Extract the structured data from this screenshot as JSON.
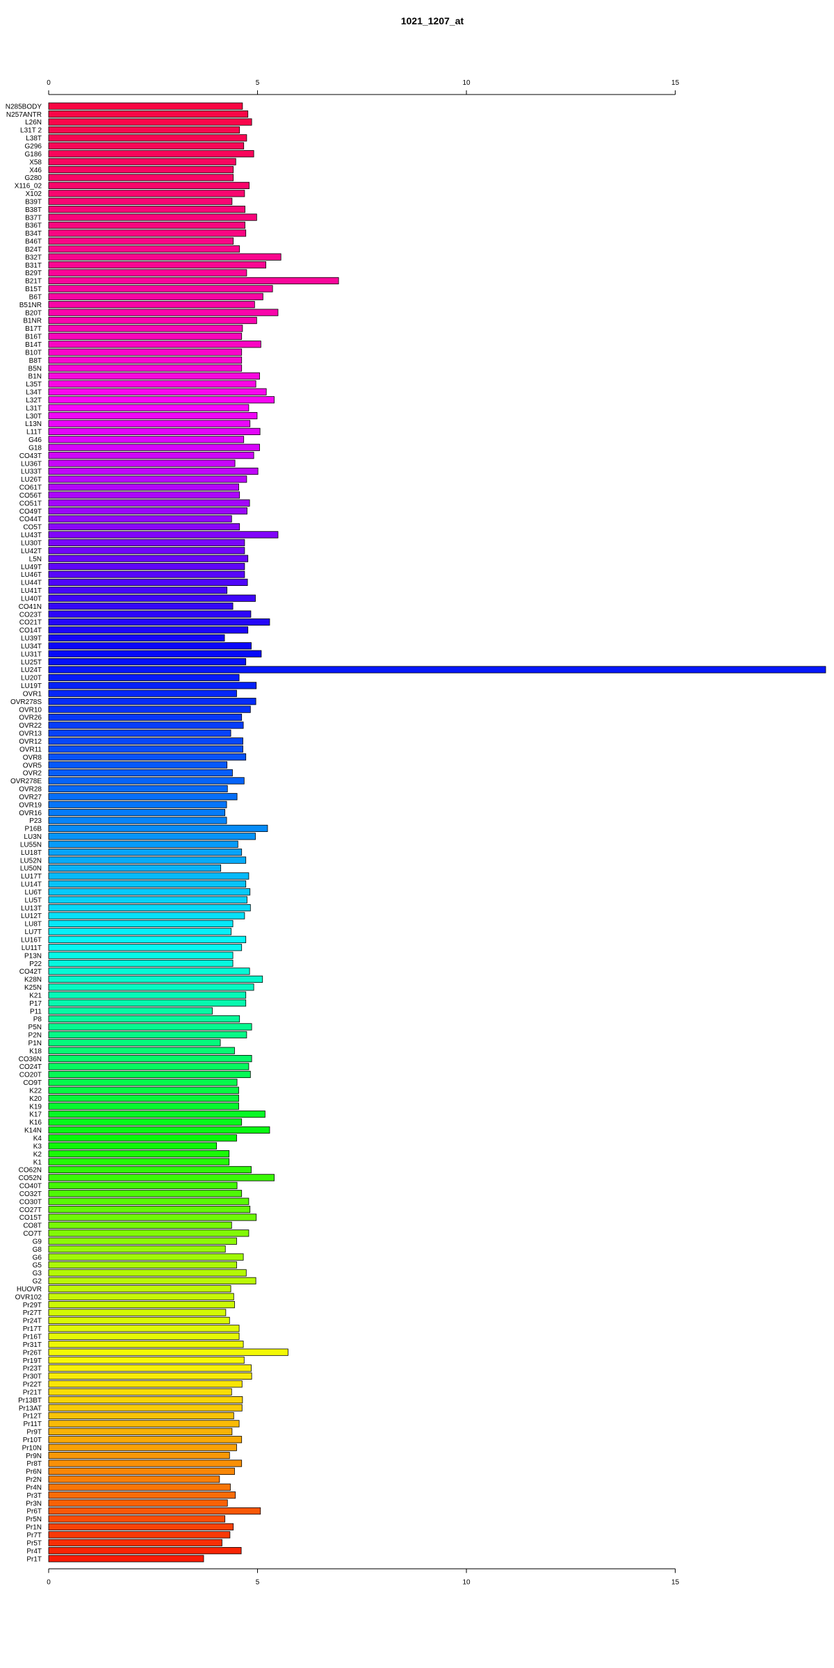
{
  "chart_data": {
    "type": "bar",
    "orientation": "horizontal",
    "title": "1021_1207_at",
    "xlabel": "",
    "ylabel": "",
    "xlim": [
      0,
      18.6
    ],
    "xticks": [
      0,
      5,
      10,
      15
    ],
    "grid": false,
    "legend": "none",
    "color_scheme": "rainbow",
    "bar_border_color": "#000000",
    "categories": [
      "N285BODY",
      "N257ANTR",
      "L26N",
      "L31T 2",
      "L38T",
      "G296",
      "G186",
      "X58",
      "X46",
      "G280",
      "X116_02",
      "X102",
      "B39T",
      "B38T",
      "B37T",
      "B36T",
      "B34T",
      "B46T",
      "B24T",
      "B32T",
      "B31T",
      "B29T",
      "B21T",
      "B15T",
      "B6T",
      "B51NR",
      "B20T",
      "B1NR",
      "B17T",
      "B16T",
      "B14T",
      "B10T",
      "B8T",
      "B5N",
      "B1N",
      "L35T",
      "L34T",
      "L32T",
      "L31T",
      "L30T",
      "L13N",
      "L11T",
      "G46",
      "G18",
      "CO43T",
      "LU36T",
      "LU33T",
      "LU26T",
      "CO61T",
      "CO56T",
      "CO51T",
      "CO49T",
      "CO44T",
      "CO5T",
      "LU43T",
      "LU30T",
      "LU42T",
      "L5N",
      "LU49T",
      "LU46T",
      "LU44T",
      "LU41T",
      "LU40T",
      "CO41N",
      "CO23T",
      "CO21T",
      "CO14T",
      "LU39T",
      "LU34T",
      "LU31T",
      "LU25T",
      "LU24T",
      "LU20T",
      "LU19T",
      "OVR1",
      "OVR278S",
      "OVR10",
      "OVR26",
      "OVR22",
      "OVR13",
      "OVR12",
      "OVR11",
      "OVR8",
      "OVR5",
      "OVR2",
      "OVR278E",
      "OVR28",
      "OVR27",
      "OVR19",
      "OVR16",
      "P23",
      "P16B",
      "LU3N",
      "LU55N",
      "LU18T",
      "LU52N",
      "LU50N",
      "LU17T",
      "LU14T",
      "LU6T",
      "LU5T",
      "LU13T",
      "LU12T",
      "LU8T",
      "LU7T",
      "LU16T",
      "LU11T",
      "P13N",
      "P22",
      "CO42T",
      "K28N",
      "K25N",
      "K21",
      "P17",
      "P11",
      "P8",
      "P5N",
      "P2N",
      "P1N",
      "K18",
      "CO36N",
      "CO24T",
      "CO20T",
      "CO9T",
      "K22",
      "K20",
      "K19",
      "K17",
      "K16",
      "K14N",
      "K4",
      "K3",
      "K2",
      "K1",
      "CO62N",
      "CO52N",
      "CO40T",
      "CO32T",
      "CO30T",
      "CO27T",
      "CO15T",
      "CO8T",
      "CO7T",
      "G9",
      "G8",
      "G6",
      "G5",
      "G3",
      "G2",
      "HUOVR",
      "OVR102",
      "Pr29T",
      "Pr27T",
      "Pr24T",
      "Pr17T",
      "Pr16T",
      "Pr31T",
      "Pr26T",
      "Pr19T",
      "Pr23T",
      "Pr30T",
      "Pr22T",
      "Pr21T",
      "Pr13BT",
      "Pr13AT",
      "Pr12T",
      "Pr11T",
      "Pr9T",
      "Pr10T",
      "Pr10N",
      "Pr9N",
      "Pr8T",
      "Pr6N",
      "Pr2N",
      "Pr4N",
      "Pr3T",
      "Pr3N",
      "Pr6T",
      "Pr5N",
      "Pr1N",
      "Pr7T",
      "Pr5T",
      "Pr4T",
      "Pr1T"
    ],
    "values": [
      4.64,
      4.77,
      4.86,
      4.57,
      4.74,
      4.67,
      4.91,
      4.48,
      4.42,
      4.42,
      4.8,
      4.69,
      4.39,
      4.7,
      4.98,
      4.7,
      4.72,
      4.42,
      4.57,
      5.56,
      5.2,
      4.74,
      6.94,
      5.36,
      5.13,
      4.93,
      5.49,
      4.98,
      4.64,
      4.62,
      5.08,
      4.62,
      4.62,
      4.62,
      5.05,
      4.96,
      5.21,
      5.4,
      4.79,
      4.99,
      4.82,
      5.06,
      4.67,
      5.05,
      4.91,
      4.46,
      5.01,
      4.74,
      4.55,
      4.57,
      4.81,
      4.75,
      4.38,
      4.57,
      5.49,
      4.69,
      4.69,
      4.77,
      4.69,
      4.69,
      4.76,
      4.27,
      4.95,
      4.41,
      4.84,
      5.29,
      4.77,
      4.21,
      4.85,
      5.09,
      4.72,
      18.6,
      4.56,
      4.97,
      4.5,
      4.96,
      4.83,
      4.62,
      4.66,
      4.36,
      4.65,
      4.65,
      4.72,
      4.27,
      4.4,
      4.68,
      4.28,
      4.51,
      4.26,
      4.22,
      4.26,
      5.24,
      4.95,
      4.53,
      4.62,
      4.72,
      4.12,
      4.79,
      4.72,
      4.82,
      4.75,
      4.83,
      4.69,
      4.41,
      4.37,
      4.72,
      4.62,
      4.41,
      4.41,
      4.81,
      5.12,
      4.91,
      4.72,
      4.72,
      3.92,
      4.57,
      4.86,
      4.74,
      4.11,
      4.45,
      4.86,
      4.79,
      4.83,
      4.51,
      4.55,
      4.55,
      4.55,
      5.18,
      4.62,
      5.29,
      4.5,
      4.02,
      4.32,
      4.32,
      4.85,
      5.4,
      4.51,
      4.62,
      4.79,
      4.82,
      4.97,
      4.38,
      4.79,
      4.5,
      4.23,
      4.66,
      4.5,
      4.73,
      4.96,
      4.36,
      4.43,
      4.45,
      4.24,
      4.33,
      4.56,
      4.56,
      4.66,
      5.73,
      4.68,
      4.85,
      4.86,
      4.63,
      4.38,
      4.64,
      4.63,
      4.43,
      4.56,
      4.39,
      4.62,
      4.5,
      4.33,
      4.62,
      4.45,
      4.09,
      4.35,
      4.47,
      4.28,
      5.07,
      4.22,
      4.42,
      4.34,
      4.15,
      4.61,
      3.71
    ]
  }
}
